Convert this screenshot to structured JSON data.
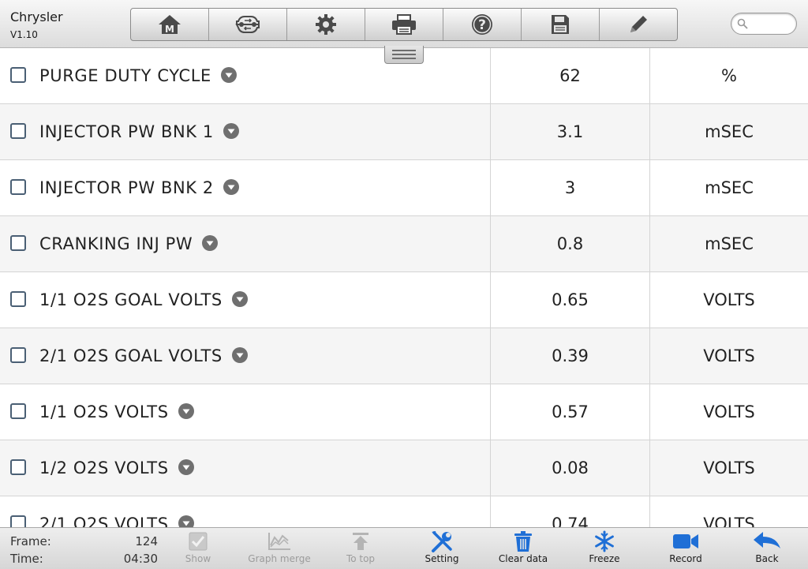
{
  "app": {
    "name": "Chrysler",
    "version": "V1.10"
  },
  "toolbar": {
    "buttons": [
      {
        "name": "home",
        "icon": "home-m-icon"
      },
      {
        "name": "vehicle-swap",
        "icon": "car-swap-icon"
      },
      {
        "name": "settings",
        "icon": "gear-icon"
      },
      {
        "name": "print",
        "icon": "printer-icon"
      },
      {
        "name": "help",
        "icon": "question-icon"
      },
      {
        "name": "save",
        "icon": "floppy-disk-icon"
      },
      {
        "name": "edit",
        "icon": "pencil-icon"
      }
    ]
  },
  "search": {
    "placeholder": ""
  },
  "parameters": [
    {
      "name": "PURGE DUTY CYCLE",
      "value": "62",
      "unit": "%"
    },
    {
      "name": "INJECTOR PW BNK 1",
      "value": "3.1",
      "unit": "mSEC"
    },
    {
      "name": "INJECTOR PW BNK 2",
      "value": "3",
      "unit": "mSEC"
    },
    {
      "name": "CRANKING INJ PW",
      "value": "0.8",
      "unit": "mSEC"
    },
    {
      "name": "1/1 O2S GOAL VOLTS",
      "value": "0.65",
      "unit": "VOLTS"
    },
    {
      "name": "2/1 O2S GOAL VOLTS",
      "value": "0.39",
      "unit": "VOLTS"
    },
    {
      "name": "1/1 O2S VOLTS",
      "value": "0.57",
      "unit": "VOLTS"
    },
    {
      "name": "1/2 O2S VOLTS",
      "value": "0.08",
      "unit": "VOLTS"
    },
    {
      "name": "2/1 O2S VOLTS",
      "value": "0.74",
      "unit": "VOLTS"
    }
  ],
  "status": {
    "frame_label": "Frame:",
    "frame_value": "124",
    "time_label": "Time:",
    "time_value": "04:30"
  },
  "actions": [
    {
      "label": "Show",
      "icon": "checkbox-icon",
      "enabled": false
    },
    {
      "label": "Graph merge",
      "icon": "graph-merge-icon",
      "enabled": false
    },
    {
      "label": "To top",
      "icon": "arrow-to-top-icon",
      "enabled": false
    },
    {
      "label": "Setting",
      "icon": "wrench-screwdriver-icon",
      "enabled": true
    },
    {
      "label": "Clear data",
      "icon": "trash-icon",
      "enabled": true
    },
    {
      "label": "Freeze",
      "icon": "snowflake-icon",
      "enabled": true
    },
    {
      "label": "Record",
      "icon": "video-camera-icon",
      "enabled": true
    },
    {
      "label": "Back",
      "icon": "back-arrow-icon",
      "enabled": true
    }
  ],
  "colors": {
    "accent_blue": "#1f6fd6",
    "disabled_gray": "#b4b4b4",
    "checkbox_border": "#4a5f74",
    "dropdown_gray": "#6f6f6f"
  }
}
